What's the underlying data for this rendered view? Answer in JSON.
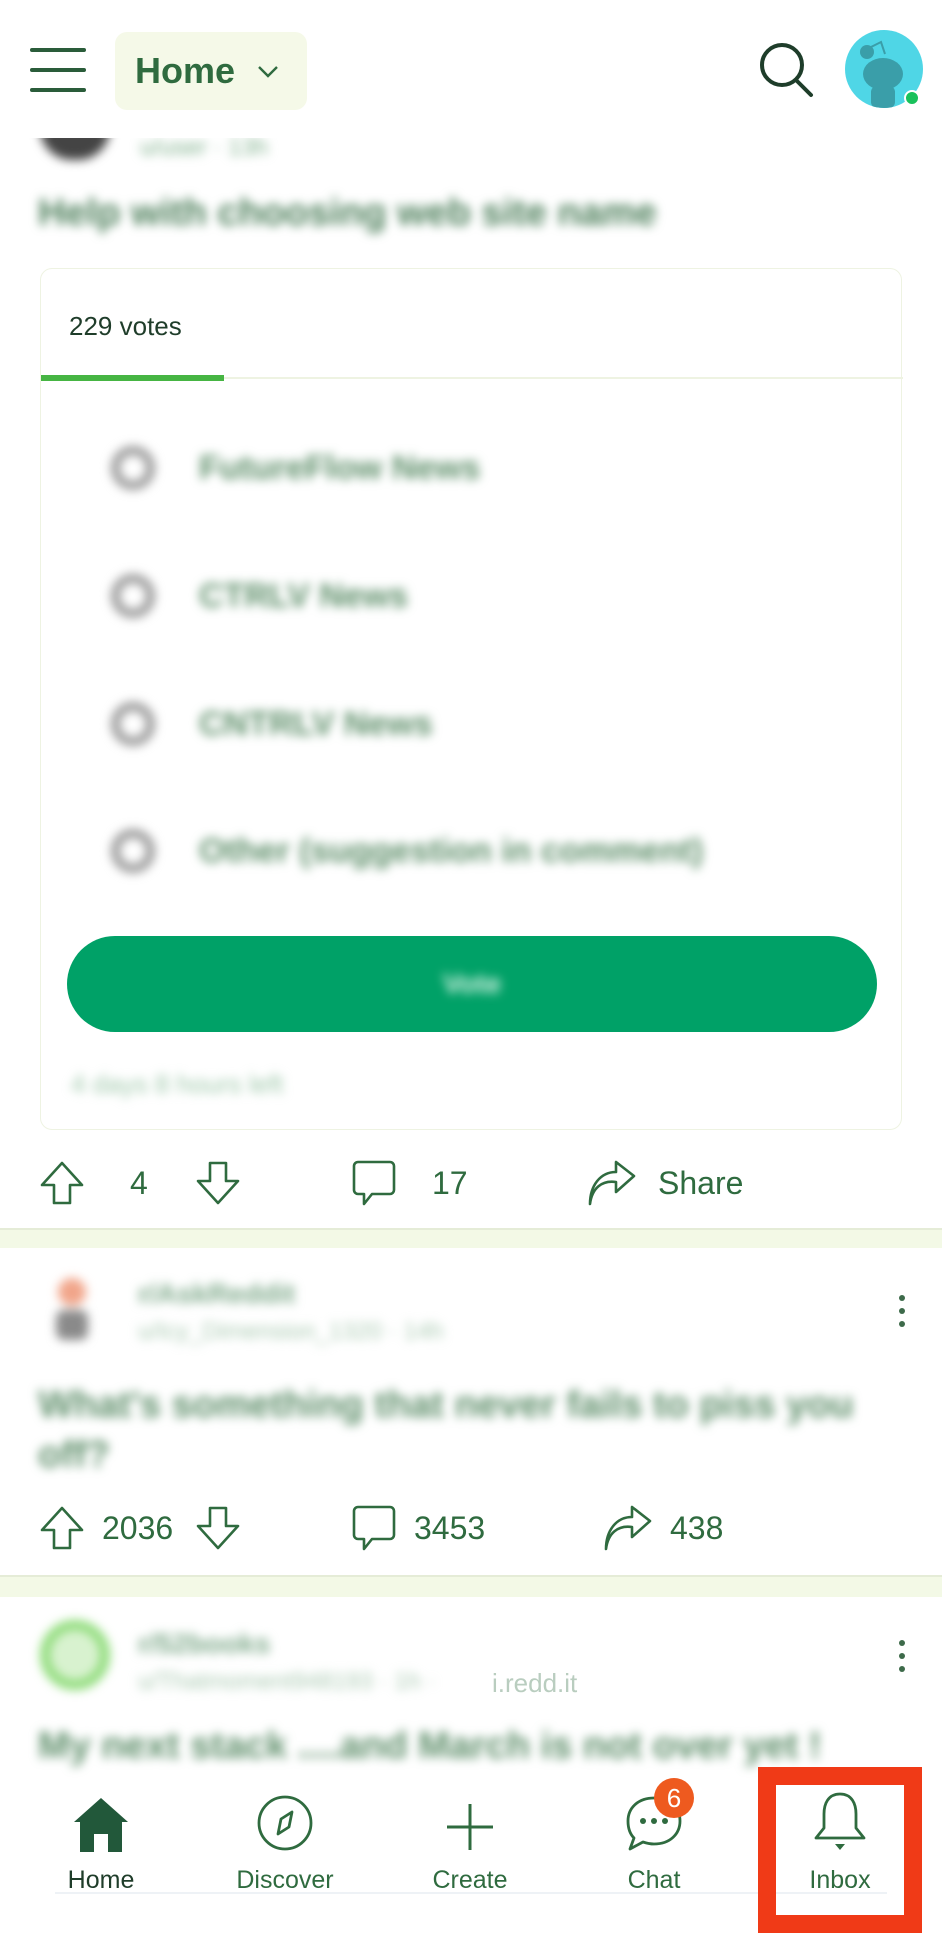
{
  "header": {
    "feed_selector": "Home",
    "menu_icon": "hamburger-menu-icon",
    "search_icon": "search-icon",
    "avatar_icon": "snoo-avatar-icon",
    "online_status": "online"
  },
  "posts": [
    {
      "author_meta": "u/user · 13h",
      "title": "Help with choosing web site name",
      "poll": {
        "votes_label": "229 votes",
        "options": [
          "FutureFlow News",
          "CTRLV News",
          "CNTRLV News",
          "Other (suggestion in comment)"
        ],
        "vote_button": "Vote",
        "time_left": "4 days 8 hours left"
      },
      "score": "4",
      "comments": "17",
      "share_label": "Share"
    },
    {
      "subreddit": "r/AskReddit",
      "author_meta": "u/Icy_Dimension_1320 · 14h",
      "title": "What's something that never fails to piss you off?",
      "score": "2036",
      "comments": "3453",
      "shares": "438"
    },
    {
      "subreddit": "r/52books",
      "author_meta": "u/Thatmoment948193 · 1h ·",
      "link_domain": "i.redd.it",
      "title": "My next stack ....and March is not over yet !"
    }
  ],
  "bottom_nav": {
    "items": [
      {
        "label": "Home",
        "icon": "home-icon",
        "active": true
      },
      {
        "label": "Discover",
        "icon": "compass-icon"
      },
      {
        "label": "Create",
        "icon": "plus-icon"
      },
      {
        "label": "Chat",
        "icon": "chat-bubble-icon",
        "badge": "6"
      },
      {
        "label": "Inbox",
        "icon": "bell-icon",
        "highlighted": true
      }
    ]
  },
  "colors": {
    "brand_green": "#2f6b3f",
    "pill_bg": "#f5f9e8",
    "vote_button": "#00a167",
    "tab_accent": "#46b543",
    "badge": "#ee5a1f",
    "highlight_box": "#f03a17",
    "avatar_bg": "#4fd6e6"
  }
}
